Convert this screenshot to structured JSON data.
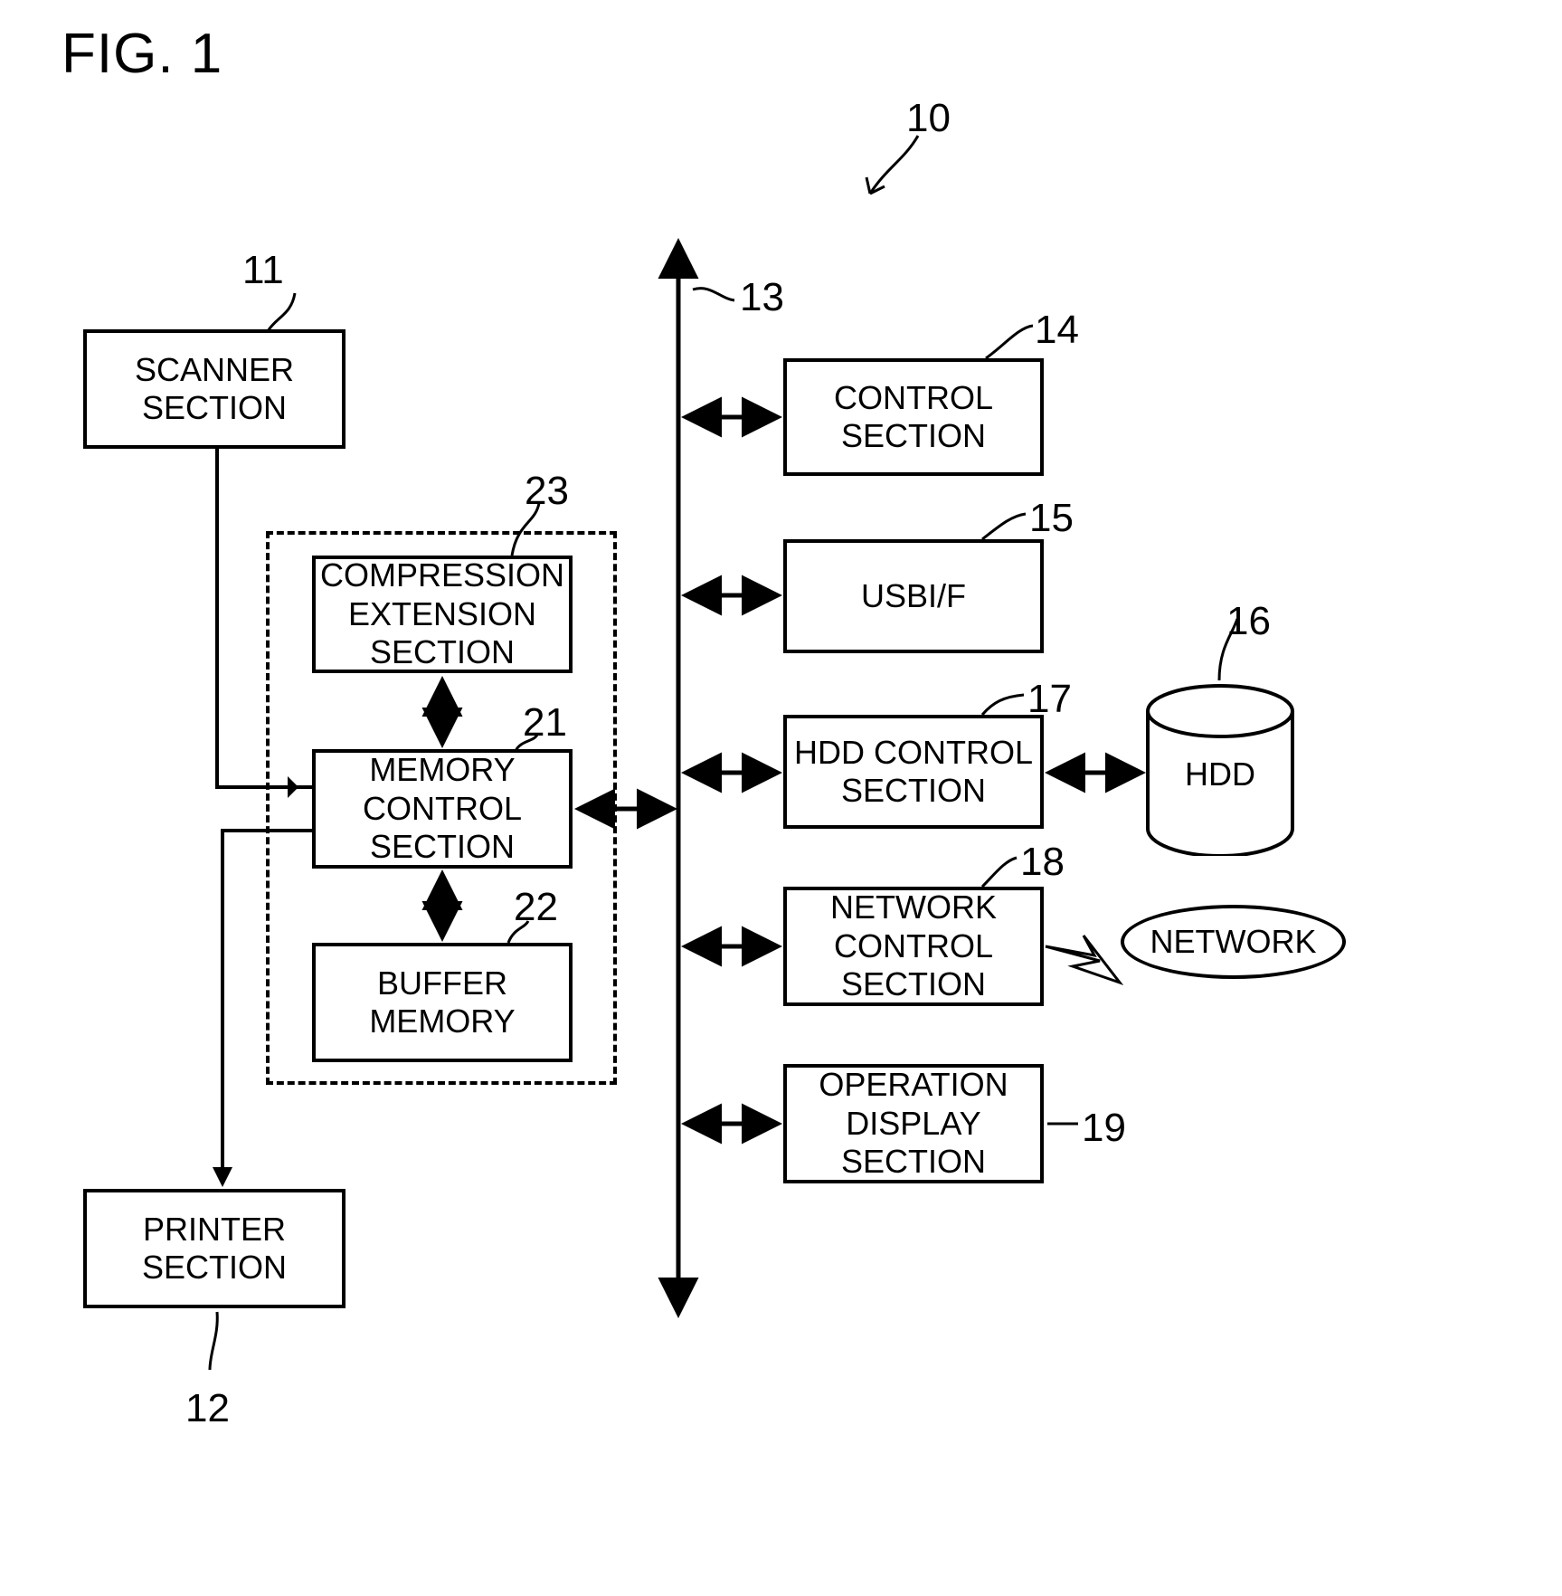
{
  "figure": {
    "title": "FIG. 1",
    "system_ref": "10"
  },
  "blocks": {
    "scanner": {
      "line1": "SCANNER",
      "line2": "SECTION",
      "ref": "11"
    },
    "printer": {
      "line1": "PRINTER",
      "line2": "SECTION",
      "ref": "12"
    },
    "compression": {
      "line1": "COMPRESSION",
      "line2": "EXTENSION",
      "line3": "SECTION",
      "ref": "23"
    },
    "memory_control": {
      "line1": "MEMORY",
      "line2": "CONTROL",
      "line3": "SECTION",
      "ref": "21"
    },
    "buffer_memory": {
      "line1": "BUFFER",
      "line2": "MEMORY",
      "ref": "22"
    },
    "control": {
      "line1": "CONTROL",
      "line2": "SECTION",
      "ref": "14"
    },
    "usb": {
      "line1": "USBI/F",
      "ref": "15"
    },
    "hdd_control": {
      "line1": "HDD CONTROL",
      "line2": "SECTION",
      "ref": "17"
    },
    "hdd": {
      "label": "HDD",
      "ref": "16"
    },
    "network_control": {
      "line1": "NETWORK",
      "line2": "CONTROL",
      "line3": "SECTION",
      "ref": "18"
    },
    "network": {
      "label": "NETWORK"
    },
    "operation_display": {
      "line1": "OPERATION",
      "line2": "DISPLAY",
      "line3": "SECTION",
      "ref": "19"
    }
  },
  "bus": {
    "ref": "13"
  },
  "colors": {
    "ink": "#000000",
    "paper": "#ffffff"
  }
}
